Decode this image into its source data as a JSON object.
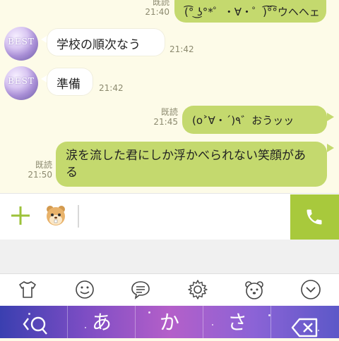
{
  "messages": [
    {
      "side": "right",
      "text": "(͡° ͜ʖ°*゜・∀・゜)͡°͡°ウヘヘェ",
      "read": "既読",
      "time": "21:40"
    },
    {
      "side": "left",
      "text": "学校の順次なう",
      "time": "21:42",
      "avatar": "BEST"
    },
    {
      "side": "left",
      "text": "準備",
      "time": "21:42",
      "avatar": "BEST"
    },
    {
      "side": "right",
      "text": "(o˃∀・´)٩゛おうッッ",
      "read": "既読",
      "time": "21:45"
    },
    {
      "side": "right",
      "text": "涙を流した君にしか浮かべられない笑顔がある",
      "read": "既読",
      "time": "21:50"
    }
  ],
  "icons": {
    "plus": "plus-icon",
    "sticker": "hamster-sticker-icon",
    "call": "phone-icon",
    "tshirt": "tshirt-icon",
    "smile": "smile-icon",
    "chat": "chat-bubble-icon",
    "gear": "gear-icon",
    "bear": "bear-icon",
    "chevron": "chevron-down-icon"
  },
  "keyboard": {
    "keys": [
      "あ",
      "か",
      "さ"
    ],
    "search_key": "search-icon",
    "delete_key": "backspace-icon"
  },
  "colors": {
    "bubble_me": "#c4d96e",
    "bubble_other": "#ffffff",
    "accent": "#a8c93c",
    "chat_bg": "#fdfbe8"
  }
}
